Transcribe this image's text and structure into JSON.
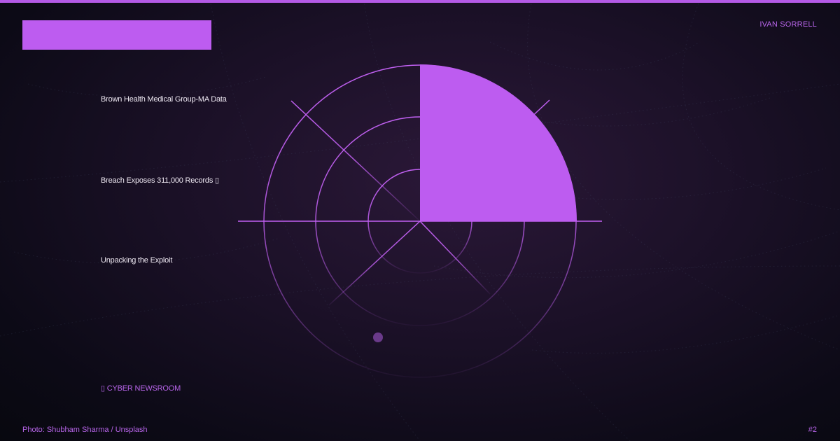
{
  "author": "IVAN SORRELL",
  "headlines": [
    "Brown Health Medical Group-MA Data",
    "Breach Exposes 311,000 Records ▯",
    "Unpacking the Exploit"
  ],
  "newsroom": "▯ CYBER NEWSROOM",
  "photo_credit": "Photo: Shubham Sharma / Unsplash",
  "page_number": "#2",
  "colors": {
    "accent": "#bd5cf0",
    "background": "#120d1c"
  },
  "icons": [
    "radar-graphic"
  ]
}
